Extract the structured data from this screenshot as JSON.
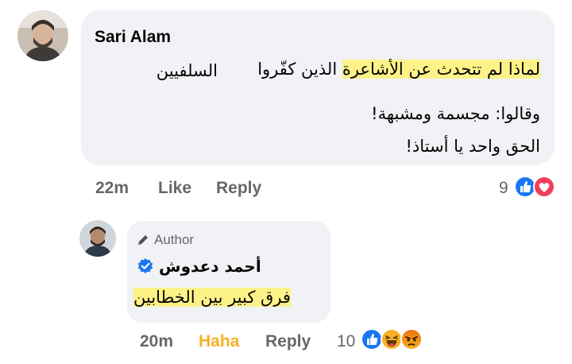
{
  "comment": {
    "author": "Sari Alam",
    "lines": [
      {
        "plain": "",
        "highlighted": "لماذا لم تتحدث عن الأشاعرة",
        "rest": " الذين كفّروا"
      },
      {
        "plain": "السلفيين",
        "highlighted": "",
        "rest": ""
      },
      {
        "plain": "وقالوا: مجسمة ومشبهة!",
        "highlighted": "",
        "rest": ""
      },
      {
        "plain": "الحق واحد يا أستاذ!",
        "highlighted": "",
        "rest": ""
      }
    ],
    "time": "22m",
    "like_label": "Like",
    "reply_label": "Reply",
    "reaction_count": "9",
    "reactions": [
      "like-icon",
      "love-icon"
    ]
  },
  "reply": {
    "badge_label": "Author",
    "author": "أحمد دعدوش",
    "text": "فرق كبير بين الخطابين",
    "time": "20m",
    "reaction_label": "Haha",
    "reply_label": "Reply",
    "reaction_count": "10",
    "reactions": [
      "like-icon",
      "haha-icon",
      "angry-icon"
    ]
  },
  "colors": {
    "bubble": "#f0f2f5",
    "highlight": "#fdf288",
    "meta_text": "#65676b",
    "haha_active": "#f7b125",
    "like_blue": "#1877f2",
    "love_red": "#f33e58",
    "verified_blue": "#1877f2"
  }
}
